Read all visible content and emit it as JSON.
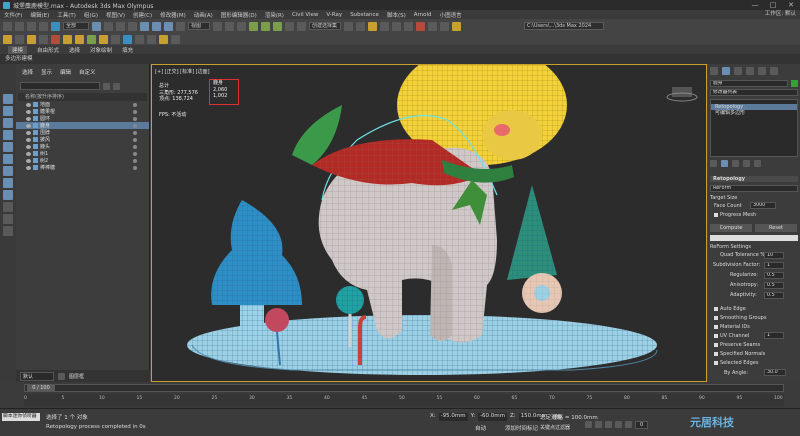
{
  "window": {
    "title": "城堡麋鹿模型.max - Autodesk 3ds Max Olympus",
    "buttons": [
      "—",
      "□",
      "✕"
    ]
  },
  "menu": {
    "items": [
      "文件(F)",
      "编辑(E)",
      "工具(T)",
      "组(G)",
      "视图(V)",
      "创建(C)",
      "修改器(M)",
      "动画(A)",
      "图形编辑器(D)",
      "渲染(R)",
      "Civil View",
      "V-Ray",
      "Substance",
      "脚本(S)",
      "Arnold",
      "小图语言"
    ],
    "workspace": "工作区: 默认"
  },
  "toolbar": {
    "selection_filter": "全部",
    "named_set": "创建选择集",
    "viewport_type": "视图",
    "path": "C:\\Users\\...\\3ds Max 2024"
  },
  "ribbon": {
    "tabs": [
      "建模",
      "自由形式",
      "选择",
      "对象绘制",
      "填充"
    ],
    "active": "建模"
  },
  "subbar": {
    "label": "多边形建模"
  },
  "scene_explorer": {
    "tabs": [
      "选择",
      "显示",
      "编辑",
      "自定义"
    ],
    "header": "名称(按升序排序)",
    "items": [
      {
        "name": "地面",
        "selected": false
      },
      {
        "name": "糖果棍",
        "selected": false
      },
      {
        "name": "圆环",
        "selected": false
      },
      {
        "name": "鹿身",
        "selected": true
      },
      {
        "name": "围脖",
        "selected": false
      },
      {
        "name": "披风",
        "selected": false
      },
      {
        "name": "鹿头",
        "selected": false
      },
      {
        "name": "树1",
        "selected": false
      },
      {
        "name": "树2",
        "selected": false
      },
      {
        "name": "棒棒糖",
        "selected": false
      }
    ],
    "footer": "默认",
    "footer_right": "图层框"
  },
  "viewport": {
    "label": "[+] [正交] [标准] [边面]",
    "stats": {
      "total_label": "总计",
      "tri_label": "三角形:",
      "tri_value": "277,576",
      "vert_label": "顶点:",
      "vert_value": "138,724",
      "sel_label": "鹿身",
      "sel_tri": "2,060",
      "sel_vert": "1,002"
    },
    "fps": "FPS: 不活动"
  },
  "command_panel": {
    "object_name": "鹿身",
    "modifier_list": "修改器列表",
    "stack": [
      "Retopology",
      "可编辑多边形"
    ],
    "rollout": "Retopology",
    "preset": "ReForm",
    "target_size": "Target Size",
    "face_count_label": "Face Count",
    "face_count": "3000",
    "progress_mesh": "Progress Mesh",
    "buttons": [
      "Compute",
      "Reset"
    ],
    "reform_settings": "ReForm Settings",
    "quad_tol_label": "Quad Tolerance %:",
    "quad_tol": "10",
    "subdiv_label": "Subdivision Factor:",
    "subdiv": "1",
    "regularize_label": "Regularize:",
    "regularize": "0.5",
    "anisotropy_label": "Anisotropy:",
    "anisotropy": "0.5",
    "adaptivity_label": "Adaptivity:",
    "adaptivity": "0.5",
    "checks": [
      "Auto Edge",
      "Smoothing Groups",
      "Material IDs",
      "UV Channel",
      "Preserve Seams",
      "Specified Normals",
      "Selected Edges"
    ],
    "uv_channel": "1",
    "by_angle_label": "By Angle:",
    "by_angle": "30.0"
  },
  "timeline": {
    "frame": "0 / 100",
    "ticks": [
      "0",
      "5",
      "10",
      "15",
      "20",
      "25",
      "30",
      "35",
      "40",
      "45",
      "50",
      "55",
      "60",
      "65",
      "70",
      "75",
      "80",
      "85",
      "90",
      "95",
      "100"
    ]
  },
  "status": {
    "selected": "选择了 1 个 对象",
    "message": "Retopology process completed in 0s",
    "script_box": "脚本迷你侦听器",
    "x_label": "X:",
    "x_val": "-95.0mm",
    "y_label": "Y:",
    "y_val": "-60.0mm",
    "z_label": "Z:",
    "z_val": "150.0mm",
    "grid": "栅格 = 100.0mm",
    "autokey": "自动",
    "setkey": "设置关键点",
    "filter": "关键点过滤器",
    "selected_set": "选定对象",
    "frame": "0",
    "time_tag": "添加时间标记"
  },
  "watermark": "元居科技"
}
